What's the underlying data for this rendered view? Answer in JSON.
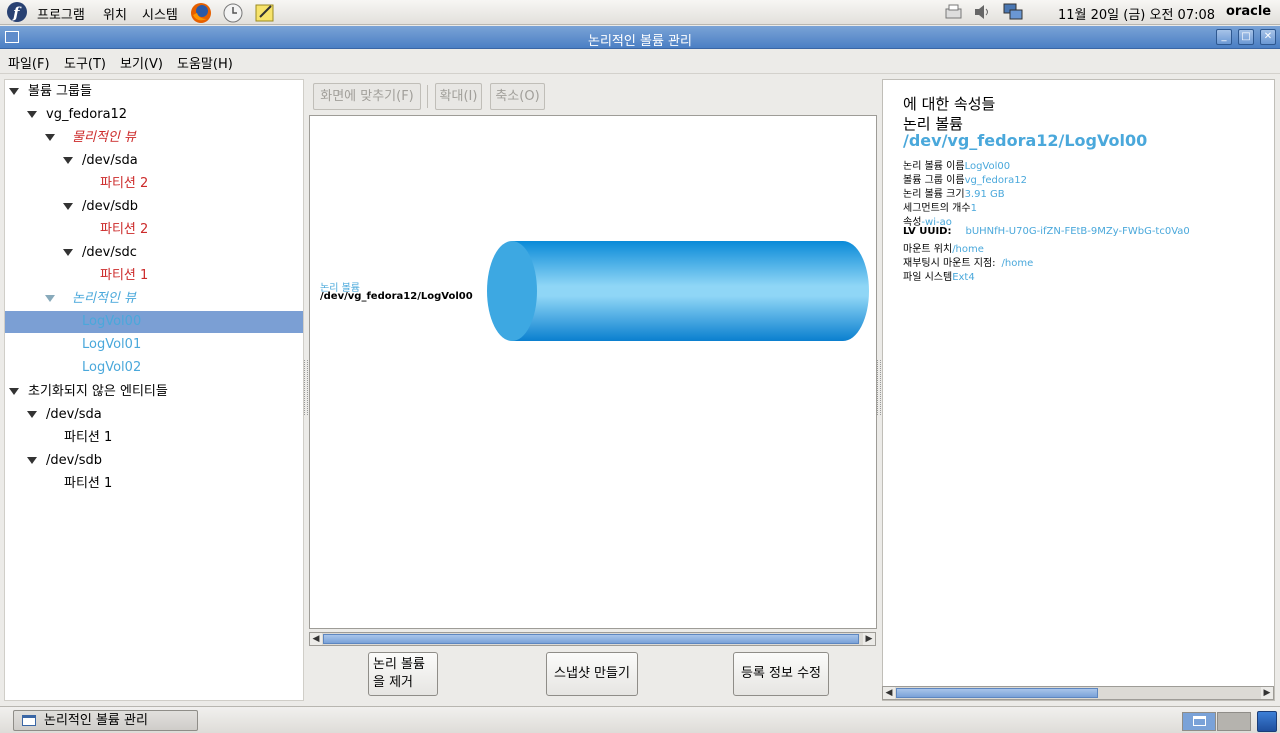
{
  "top_panel": {
    "menus": [
      "프로그램",
      "위치",
      "시스템"
    ],
    "clock": "11월 20일 (금) 오전 07:08",
    "user": "oracle"
  },
  "window": {
    "title": "논리적인 볼륨 관리"
  },
  "menubar": [
    "파일(F)",
    "도구(T)",
    "보기(V)",
    "도움말(H)"
  ],
  "tree": {
    "volume_groups": "볼륨 그룹들",
    "vg_name": "vg_fedora12",
    "physical_view": "물리적인 뷰",
    "dev_sda": "/dev/sda",
    "partition_2a": "파티션 2",
    "dev_sdb": "/dev/sdb",
    "partition_2b": "파티션 2",
    "dev_sdc": "/dev/sdc",
    "partition_1c": "파티션 1",
    "logical_view": "논리적인 뷰",
    "lv0": "LogVol00",
    "lv1": "LogVol01",
    "lv2": "LogVol02",
    "uninit": "초기화되지 않은 엔티티들",
    "u_sda": "/dev/sda",
    "u_sda_part": "파티션 1",
    "u_sdb": "/dev/sdb",
    "u_sdb_part": "파티션 1"
  },
  "toolbar": {
    "fit": "화면에 맞추기(F)",
    "zoom_in": "확대(I)",
    "zoom_out": "축소(O)"
  },
  "canvas": {
    "label_type": "논리 볼륨",
    "label_path": "/dev/vg_fedora12/LogVol00"
  },
  "actions": {
    "remove_line1": "논리 볼륨",
    "remove_line2": "을 제거",
    "snapshot": "스냅샷 만들기",
    "edit": "등록 정보 수정"
  },
  "properties": {
    "heading1": "에 대한 속성들",
    "heading2": "논리 볼륨",
    "heading3": "/dev/vg_fedora12/LogVol00",
    "rows": [
      {
        "label": "논리 볼륨 이름",
        "value": "LogVol00"
      },
      {
        "label": "볼륨 그룹 이름",
        "value": "vg_fedora12"
      },
      {
        "label": "논리 볼륨 크기",
        "value": "3.91 GB"
      },
      {
        "label": "세그먼트의 개수",
        "value": "1"
      },
      {
        "label": "속성",
        "value": "-wi-ao"
      },
      {
        "label": "LV UUID:",
        "value": "bUHNfH-U70G-ifZN-FEtB-9MZy-FWbG-tc0Va0"
      },
      {
        "label": "마운트 위치",
        "value": "/home"
      },
      {
        "label": "재부팅시 마운트 지점:",
        "value": "/home"
      },
      {
        "label": "파일 시스템",
        "value": "Ext4"
      }
    ]
  },
  "taskbar": {
    "task": "논리적인 볼륨 관리"
  },
  "colors": {
    "accent": "#4aa8db",
    "physical_red": "#cc2a2a",
    "selection": "#7b9fd4",
    "title_blue": "#4b7fc4"
  }
}
